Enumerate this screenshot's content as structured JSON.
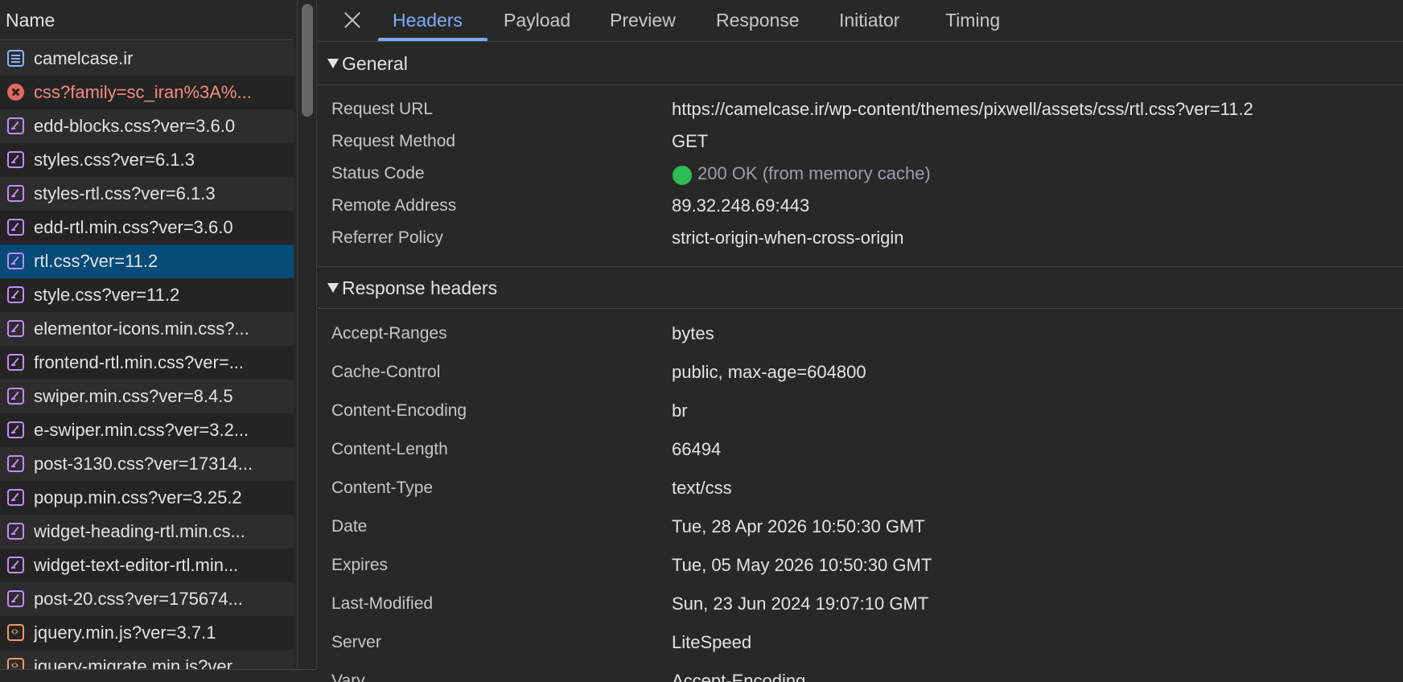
{
  "list": {
    "header": "Name",
    "rows": [
      {
        "name": "camelcase.ir",
        "type": "doc"
      },
      {
        "name": "css?family=sc_iran%3A%...",
        "type": "err"
      },
      {
        "name": "edd-blocks.css?ver=3.6.0",
        "type": "css"
      },
      {
        "name": "styles.css?ver=6.1.3",
        "type": "css"
      },
      {
        "name": "styles-rtl.css?ver=6.1.3",
        "type": "css"
      },
      {
        "name": "edd-rtl.min.css?ver=3.6.0",
        "type": "css"
      },
      {
        "name": "rtl.css?ver=11.2",
        "type": "css",
        "selected": true
      },
      {
        "name": "style.css?ver=11.2",
        "type": "css"
      },
      {
        "name": "elementor-icons.min.css?...",
        "type": "css"
      },
      {
        "name": "frontend-rtl.min.css?ver=...",
        "type": "css"
      },
      {
        "name": "swiper.min.css?ver=8.4.5",
        "type": "css"
      },
      {
        "name": "e-swiper.min.css?ver=3.2...",
        "type": "css"
      },
      {
        "name": "post-3130.css?ver=17314...",
        "type": "css"
      },
      {
        "name": "popup.min.css?ver=3.25.2",
        "type": "css"
      },
      {
        "name": "widget-heading-rtl.min.cs...",
        "type": "css"
      },
      {
        "name": "widget-text-editor-rtl.min...",
        "type": "css"
      },
      {
        "name": "post-20.css?ver=175674...",
        "type": "css"
      },
      {
        "name": "jquery.min.js?ver=3.7.1",
        "type": "js"
      },
      {
        "name": "jquery-migrate.min.js?ver...",
        "type": "js"
      }
    ]
  },
  "tabs": [
    "Headers",
    "Payload",
    "Preview",
    "Response",
    "Initiator",
    "Timing"
  ],
  "active_tab": "Headers",
  "general": {
    "title": "General",
    "request_url_label": "Request URL",
    "request_url": "https://camelcase.ir/wp-content/themes/pixwell/assets/css/rtl.css?ver=11.2",
    "request_method_label": "Request Method",
    "request_method": "GET",
    "status_code_label": "Status Code",
    "status_code": "200 OK (from memory cache)",
    "status_color": "#2bbd53",
    "remote_address_label": "Remote Address",
    "remote_address": "89.32.248.69:443",
    "referrer_policy_label": "Referrer Policy",
    "referrer_policy": "strict-origin-when-cross-origin"
  },
  "response_headers": {
    "title": "Response headers",
    "items": [
      {
        "key": "Accept-Ranges",
        "value": "bytes"
      },
      {
        "key": "Cache-Control",
        "value": "public, max-age=604800"
      },
      {
        "key": "Content-Encoding",
        "value": "br"
      },
      {
        "key": "Content-Length",
        "value": "66494"
      },
      {
        "key": "Content-Type",
        "value": "text/css"
      },
      {
        "key": "Date",
        "value": "Tue, 28 Apr 2026 10:50:30 GMT"
      },
      {
        "key": "Expires",
        "value": "Tue, 05 May 2026 10:50:30 GMT"
      },
      {
        "key": "Last-Modified",
        "value": "Sun, 23 Jun 2024 19:07:10 GMT"
      },
      {
        "key": "Server",
        "value": "LiteSpeed"
      },
      {
        "key": "Vary",
        "value": "Accept-Encoding"
      }
    ]
  }
}
